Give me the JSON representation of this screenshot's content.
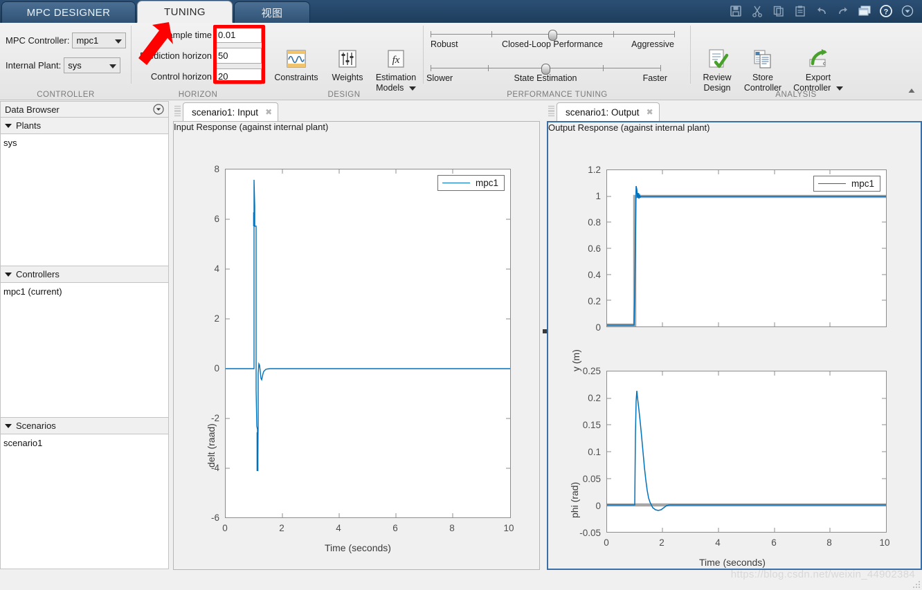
{
  "app": {
    "title_tab": "MPC DESIGNER",
    "tabs": [
      {
        "label": "MPC DESIGNER",
        "active": false
      },
      {
        "label": "TUNING",
        "active": true
      },
      {
        "label": "视图",
        "active": false
      }
    ]
  },
  "quick_access": {
    "items": [
      {
        "name": "save-icon",
        "label": "Save",
        "enabled": false
      },
      {
        "name": "cut-icon",
        "label": "Cut",
        "enabled": false
      },
      {
        "name": "copy-icon",
        "label": "Copy",
        "enabled": false
      },
      {
        "name": "paste-icon",
        "label": "Paste",
        "enabled": false
      },
      {
        "name": "undo-icon",
        "label": "Undo",
        "enabled": false
      },
      {
        "name": "redo-icon",
        "label": "Redo",
        "enabled": false
      },
      {
        "name": "layout-icon",
        "label": "Layout",
        "enabled": true
      },
      {
        "name": "help-icon",
        "label": "Help",
        "enabled": true
      },
      {
        "name": "chevron-down-icon",
        "label": "More",
        "enabled": true
      }
    ]
  },
  "ribbon": {
    "groups": [
      {
        "name": "CONTROLLER"
      },
      {
        "name": "HORIZON"
      },
      {
        "name": "DESIGN"
      },
      {
        "name": "PERFORMANCE TUNING"
      },
      {
        "name": "ANALYSIS"
      }
    ],
    "controller": {
      "group_label": "CONTROLLER",
      "mpc_controller_label": "MPC Controller:",
      "mpc_controller_value": "mpc1",
      "internal_plant_label": "Internal Plant:",
      "internal_plant_value": "sys"
    },
    "horizon": {
      "group_label": "HORIZON",
      "sample_time_label": "Sample time",
      "sample_time_value": "0.01",
      "prediction_horizon_label": "Prediction horizon",
      "prediction_horizon_value": "50",
      "control_horizon_label": "Control horizon",
      "control_horizon_value": "20"
    },
    "design": {
      "group_label": "DESIGN",
      "buttons": [
        {
          "label": "Constraints",
          "icon": "constraints-icon"
        },
        {
          "label": "Weights",
          "icon": "weights-icon"
        },
        {
          "label": "Estimation\nModels",
          "label_line1": "Estimation",
          "label_line2": "Models",
          "icon": "estimation-models-icon",
          "has_dropdown": true
        }
      ]
    },
    "performance_tuning": {
      "group_label": "PERFORMANCE TUNING",
      "sliders": [
        {
          "name": "closed-loop-performance",
          "left_label": "Robust",
          "center_label": "Closed-Loop Performance",
          "right_label": "Aggressive",
          "value_pct": 50
        },
        {
          "name": "state-estimation",
          "left_label": "Slower",
          "center_label": "State Estimation",
          "right_label": "Faster",
          "value_pct": 50
        }
      ]
    },
    "analysis": {
      "group_label": "ANALYSIS",
      "buttons": [
        {
          "label_line1": "Review",
          "label_line2": "Design",
          "icon": "review-design-icon",
          "has_dropdown": false
        },
        {
          "label_line1": "Store",
          "label_line2": "Controller",
          "icon": "store-controller-icon",
          "has_dropdown": false
        },
        {
          "label_line1": "Export",
          "label_line2": "Controller",
          "icon": "export-controller-icon",
          "has_dropdown": true
        }
      ]
    }
  },
  "sidebar": {
    "title": "Data Browser",
    "sections": [
      {
        "name": "plants",
        "header": "Plants",
        "items": [
          "sys"
        ]
      },
      {
        "name": "controllers",
        "header": "Controllers",
        "items": [
          "mpc1 (current)"
        ]
      },
      {
        "name": "scenarios",
        "header": "Scenarios",
        "items": [
          "scenario1"
        ]
      }
    ]
  },
  "documents": {
    "left": {
      "tab_label": "scenario1: Input",
      "close_glyph": "✖",
      "focused": false
    },
    "right": {
      "tab_label": "scenario1: Output",
      "close_glyph": "✖",
      "focused": true
    }
  },
  "watermark": "https://blog.csdn.net/weixin_44902384",
  "annotations": {
    "arrow": {
      "name": "red-arrow-annotation",
      "color": "#ff0000"
    },
    "box": {
      "name": "red-highlight-box",
      "color": "#ff0000"
    }
  },
  "colors": {
    "accent_blue": "#0072bd",
    "reference_gray": "#a6a6a6",
    "ribbon_bg": "#eeeeee",
    "title_blue": "#2b4f74",
    "annotation_red": "#ff0000",
    "focus_border": "#3a6ea5"
  },
  "chart_data": [
    {
      "type": "line",
      "name": "input-response",
      "title": "Input Response (against internal plant)",
      "xlabel": "Time (seconds)",
      "ylabel": "delt (raad)",
      "xlim": [
        0,
        10
      ],
      "ylim": [
        -6,
        8
      ],
      "xticks": [
        0,
        2,
        4,
        6,
        8,
        10
      ],
      "yticks": [
        -6,
        -4,
        -2,
        0,
        2,
        4,
        6,
        8
      ],
      "grid": false,
      "legend": {
        "position": "top-right",
        "entries": [
          "mpc1"
        ]
      },
      "series": [
        {
          "name": "mpc1",
          "color": "#0072bd",
          "x": [
            0,
            0.2,
            0.4,
            0.6,
            0.8,
            0.95,
            1.0,
            1.01,
            1.02,
            1.03,
            1.05,
            1.07,
            1.09,
            1.11,
            1.13,
            1.15,
            1.17,
            1.2,
            1.25,
            1.3,
            1.35,
            1.4,
            1.45,
            1.5,
            1.6,
            1.7,
            1.8,
            2.0,
            3.0,
            5.0,
            7.0,
            10.0
          ],
          "y": [
            0,
            0,
            0,
            0,
            0,
            0,
            0,
            7.55,
            6.5,
            5.7,
            5.7,
            -0.85,
            -2.3,
            -2.45,
            -4.1,
            -2.35,
            -0.2,
            0.2,
            0.1,
            -0.15,
            -0.55,
            -0.45,
            -0.2,
            -0.1,
            -0.05,
            -0.05,
            0,
            0,
            0,
            0,
            0,
            0
          ]
        }
      ]
    },
    {
      "type": "line",
      "name": "output-response-y",
      "title": "Output Response (against internal plant)",
      "xlabel": "",
      "ylabel": "y (m)",
      "xlim": [
        0,
        10
      ],
      "ylim": [
        0,
        1.2
      ],
      "xticks": [
        0,
        2,
        4,
        6,
        8,
        10
      ],
      "yticks": [
        0,
        0.2,
        0.4,
        0.6,
        0.8,
        1,
        1.2
      ],
      "grid": false,
      "legend": {
        "position": "top-right",
        "entries": [
          "mpc1"
        ]
      },
      "series": [
        {
          "name": "reference",
          "color": "#a6a6a6",
          "x": [
            0,
            0.99,
            1.0,
            1.0,
            10
          ],
          "y": [
            0,
            0,
            0,
            1,
            1
          ]
        },
        {
          "name": "mpc1",
          "color": "#0072bd",
          "x": [
            0,
            0.5,
            0.99,
            1.0,
            1.02,
            1.05,
            1.07,
            1.1,
            1.13,
            1.17,
            1.22,
            1.3,
            1.5,
            2,
            4,
            6,
            8,
            10
          ],
          "y": [
            0,
            0,
            0,
            0.22,
            0.66,
            1.08,
            0.99,
            1.06,
            1.0,
            1.02,
            1.0,
            1.0,
            1.0,
            1.0,
            1.0,
            1.0,
            1.0,
            1.0
          ]
        }
      ]
    },
    {
      "type": "line",
      "name": "output-response-phi",
      "title": "",
      "xlabel": "Time (seconds)",
      "ylabel": "phi (rad)",
      "xlim": [
        0,
        10
      ],
      "ylim": [
        -0.05,
        0.25
      ],
      "xticks": [
        0,
        2,
        4,
        6,
        8,
        10
      ],
      "yticks": [
        -0.05,
        0,
        0.05,
        0.1,
        0.15,
        0.2,
        0.25
      ],
      "grid": false,
      "legend": null,
      "series": [
        {
          "name": "reference",
          "color": "#a6a6a6",
          "x": [
            0,
            10
          ],
          "y": [
            0,
            0
          ]
        },
        {
          "name": "mpc1",
          "color": "#0072bd",
          "x": [
            0,
            0.5,
            0.99,
            1.0,
            1.03,
            1.06,
            1.08,
            1.1,
            1.15,
            1.2,
            1.25,
            1.3,
            1.35,
            1.4,
            1.5,
            1.6,
            1.7,
            1.8,
            1.9,
            2.0,
            3.0,
            5.0,
            7.0,
            10.0
          ],
          "y": [
            0,
            0,
            0,
            0.0,
            0.13,
            0.195,
            0.213,
            0.2,
            0.155,
            0.105,
            0.06,
            0.03,
            0.012,
            0.0,
            -0.008,
            -0.012,
            -0.01,
            -0.005,
            -0.001,
            0,
            0,
            0,
            0,
            0
          ]
        }
      ]
    }
  ]
}
